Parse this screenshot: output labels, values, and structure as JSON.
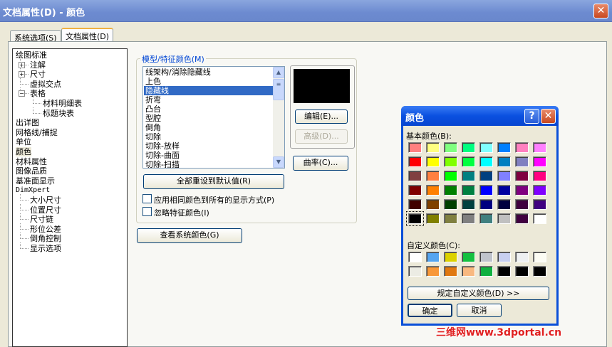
{
  "window": {
    "title": "文档属性(D) - 颜色",
    "close_icon": "close-icon"
  },
  "tabs": [
    {
      "label": "系统选项(S)"
    },
    {
      "label": "文档属性(D)",
      "selected": true
    }
  ],
  "tree": [
    {
      "label": "绘图标准",
      "level": 0
    },
    {
      "label": "注解",
      "level": 1,
      "expander": "+"
    },
    {
      "label": "尺寸",
      "level": 1,
      "expander": "+"
    },
    {
      "label": "虚拟交点",
      "level": 1
    },
    {
      "label": "表格",
      "level": 1,
      "expander": "-"
    },
    {
      "label": "材料明细表",
      "level": 2
    },
    {
      "label": "标题块表",
      "level": 2
    },
    {
      "label": "出详图",
      "level": 0
    },
    {
      "label": "网格线/捕捉",
      "level": 0
    },
    {
      "label": "单位",
      "level": 0
    },
    {
      "label": "颜色",
      "level": 0,
      "selected": true
    },
    {
      "label": "材料属性",
      "level": 0
    },
    {
      "label": "图像品质",
      "level": 0
    },
    {
      "label": "基准面显示",
      "level": 0
    },
    {
      "label": "DimXpert",
      "level": 0
    },
    {
      "label": "大小尺寸",
      "level": 1
    },
    {
      "label": "位置尺寸",
      "level": 1
    },
    {
      "label": "尺寸链",
      "level": 1
    },
    {
      "label": "形位公差",
      "level": 1
    },
    {
      "label": "倒角控制",
      "level": 1
    },
    {
      "label": "显示选项",
      "level": 1
    }
  ],
  "model_colors": {
    "legend": "模型/特征颜色(M)",
    "items": [
      "线架构/消除隐藏线",
      "上色",
      "隐藏线",
      "折弯",
      "凸台",
      "型腔",
      "倒角",
      "切除",
      "切除-放样",
      "切除-曲面",
      "切除-扫描"
    ],
    "selected": "隐藏线",
    "preview_color": "#000000",
    "edit_button": "编辑(E)...",
    "advanced_button": "高级(D)...",
    "curvature_button": "曲率(C)...",
    "reset_button": "全部重设到默认值(R)",
    "apply_same_checkbox": {
      "label": "应用相同颜色到所有的显示方式(P)",
      "checked": false
    },
    "ignore_feature_checkbox": {
      "label": "忽略特征颜色(I)",
      "checked": false
    }
  },
  "view_system_colors_button": "查看系统颜色(G)",
  "color_dialog": {
    "title": "颜色",
    "help_icon": "help-icon",
    "basic_label": "基本颜色(B):",
    "basic_colors": [
      [
        "#ff8080",
        "#ffff80",
        "#80ff80",
        "#00ff80",
        "#80ffff",
        "#0080ff",
        "#ff80c0",
        "#ff80ff"
      ],
      [
        "#ff0000",
        "#ffff00",
        "#80ff00",
        "#00ff40",
        "#00ffff",
        "#0080c0",
        "#8080c0",
        "#ff00ff"
      ],
      [
        "#804040",
        "#ff8040",
        "#00ff00",
        "#008080",
        "#004080",
        "#8080ff",
        "#800040",
        "#ff0080"
      ],
      [
        "#800000",
        "#ff8000",
        "#008000",
        "#008040",
        "#0000ff",
        "#0000a0",
        "#800080",
        "#8000ff"
      ],
      [
        "#400000",
        "#804000",
        "#004000",
        "#004040",
        "#000080",
        "#000040",
        "#400040",
        "#400080"
      ],
      [
        "#000000",
        "#808000",
        "#808040",
        "#808080",
        "#408080",
        "#c0c0c0",
        "#400040",
        "#ffffff"
      ]
    ],
    "selected_color": "#000000",
    "custom_label": "自定义颜色(C):",
    "custom_colors": [
      [
        "#ffffff",
        "#55a5f0",
        "#dcd200",
        "#14c040",
        "#c0c4cc",
        "#c8d0f0",
        "#eef0f2",
        "#fcfcf4"
      ],
      [
        "#ecece4",
        "#f89838",
        "#e07810",
        "#f8b880",
        "#10b040",
        "#000000",
        "#000000",
        "#000000"
      ]
    ],
    "define_custom_button": "规定自定义颜色(D) >>",
    "ok_button": "确定",
    "cancel_button": "取消"
  },
  "watermark": "三维网www.3dportal.cn"
}
